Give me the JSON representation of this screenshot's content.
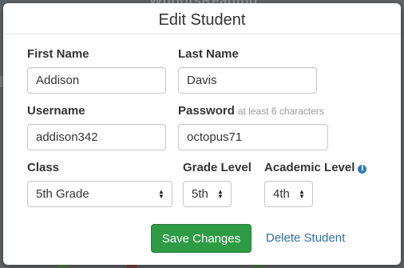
{
  "background": {
    "logo_text": "WhootsReading"
  },
  "modal": {
    "title": "Edit Student"
  },
  "form": {
    "first_name": {
      "label": "First Name",
      "value": "Addison"
    },
    "last_name": {
      "label": "Last Name",
      "value": "Davis"
    },
    "username": {
      "label": "Username",
      "value": "addison342"
    },
    "password": {
      "label": "Password",
      "hint": "at least 6 characters",
      "value": "octopus71"
    },
    "class": {
      "label": "Class",
      "selected": "5th Grade"
    },
    "grade_level": {
      "label": "Grade Level",
      "selected": "5th"
    },
    "academic_level": {
      "label": "Academic Level",
      "info_icon": "info-icon",
      "selected": "4th"
    }
  },
  "actions": {
    "save_label": "Save Changes",
    "delete_label": "Delete Student"
  },
  "colors": {
    "save_button": "#2e9b45",
    "link": "#2f6fab",
    "info_icon": "#2f7bbf",
    "overlay": "#606366"
  }
}
